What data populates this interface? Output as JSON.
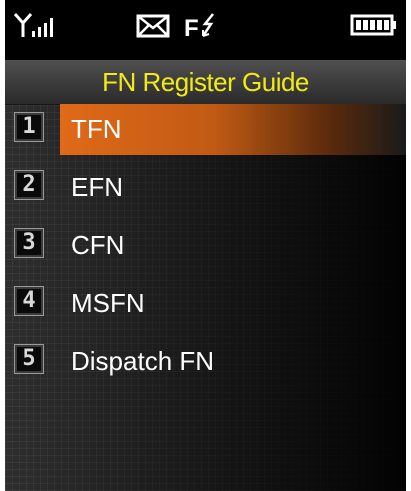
{
  "status_bar": {
    "icons": [
      "signal-strength-icon",
      "message-envelope-icon",
      "call-forward-icon",
      "battery-icon"
    ],
    "forward_text": "F"
  },
  "title": "FN Register Guide",
  "menu": {
    "items": [
      {
        "number": "1",
        "label": "TFN",
        "selected": true
      },
      {
        "number": "2",
        "label": "EFN",
        "selected": false
      },
      {
        "number": "3",
        "label": "CFN",
        "selected": false
      },
      {
        "number": "4",
        "label": "MSFN",
        "selected": false
      },
      {
        "number": "5",
        "label": "Dispatch FN",
        "selected": false
      }
    ]
  },
  "colors": {
    "title_text": "#f2ea15",
    "highlight": "#e06a18",
    "background": "#2e2e2e"
  }
}
